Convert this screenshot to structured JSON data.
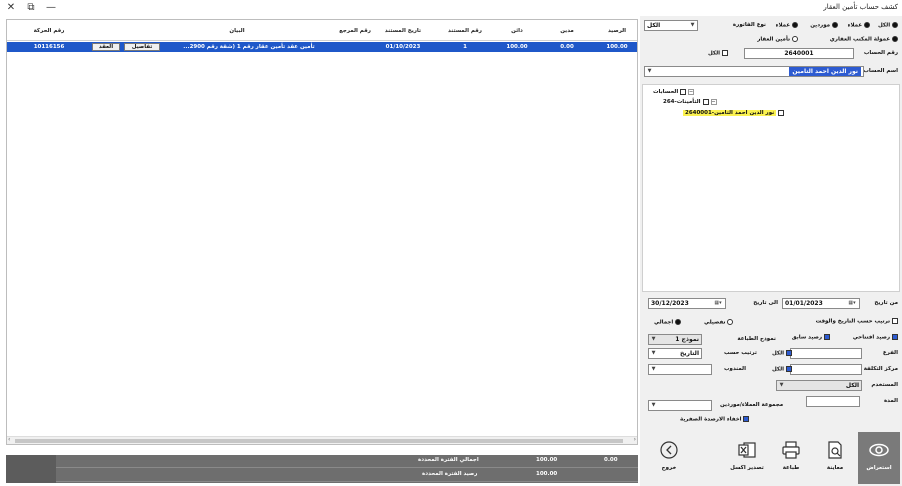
{
  "window": {
    "title": "كشف حساب تأمين العقار",
    "close_glyph": "✕",
    "restore_glyph": "⧉",
    "minimize_glyph": "—"
  },
  "grid": {
    "headers": [
      "الرصيد",
      "مدين",
      "دائن",
      "رقم المستند",
      "تاريخ المستند",
      "رقم المرجع",
      "البيان",
      "رقم الحركة"
    ],
    "row": {
      "balance": "100.00",
      "debit": "0.00",
      "credit": "100.00",
      "doc_no": "1",
      "doc_date": "01/10/2023",
      "ref_no": "",
      "description": "تأمين عقد تأمين عقار رقم 1 (شقة رقم 2900...",
      "details_button": "تفاصيل",
      "contract_button": "العقد",
      "movement_no": "10116156"
    }
  },
  "footer": {
    "period_total_label": "اجمالي الفترة المحددة",
    "period_total_credit": "100.00",
    "period_total_debit": "0.00",
    "period_balance_label": "رصيد الفترة المحددة",
    "period_balance_value": "100.00"
  },
  "panel": {
    "type_all": "الكل",
    "type_sales": "عملاء",
    "type_suppliers": "موردين",
    "type_employees": "عملاء",
    "invoice_type_label": "نوع الفاتورة",
    "invoice_type_value": "الكل",
    "office_commission": "عمولة المكتب العقاري",
    "property_insurance": "تأمين العقار",
    "account_no_label": "رقم الحساب",
    "account_no_value": "2640001",
    "all_label": "الكل",
    "account_name_label": "اسم الحساب",
    "account_name_value": "نور الدين احمد التامين",
    "tree": {
      "root": "الحسابات",
      "level1": "التأمينات-264",
      "level2": "نور الدين احمد التامين-2640001"
    },
    "from_date_label": "من تاريخ",
    "from_date_value": "01/01/2023",
    "to_date_label": "الى تاريخ",
    "to_date_value": "30/12/2023",
    "sort_by_date": "ترتيب حسب التاريخ والوقت",
    "radio_detailed": "تفصيلي",
    "radio_total": "اجمالي",
    "opening_balance": "رصيد افتتاحي",
    "prev_balance": "رصيد سابق",
    "form_label": "نموذج الطباعة",
    "form_value": "نموذج 1",
    "branch_label": "الفرع",
    "cost_center_label": "مركز التكلفة",
    "branch_all": "الكل",
    "cost_all": "الكل",
    "order_by_label": "ترتيب حسب",
    "order_by_value": "التاريخ",
    "delegate_label": "المندوب",
    "store_label": "المستخدم",
    "store_value": "الكل",
    "duration_label": "المدة",
    "customers_group_label": "مجموعة العملاء/موردين",
    "hide_zero": "اخفاء الارصدة الصفرية"
  },
  "buttons": {
    "view": "استعراض",
    "preview": "معاينة",
    "print": "طباعة",
    "export_excel": "تصدير اكسل",
    "exit": "خروج"
  },
  "colors": {
    "row_selected": "#1f58c9",
    "highlight": "#fbf250",
    "footer_bg": "#6e6e6e"
  }
}
